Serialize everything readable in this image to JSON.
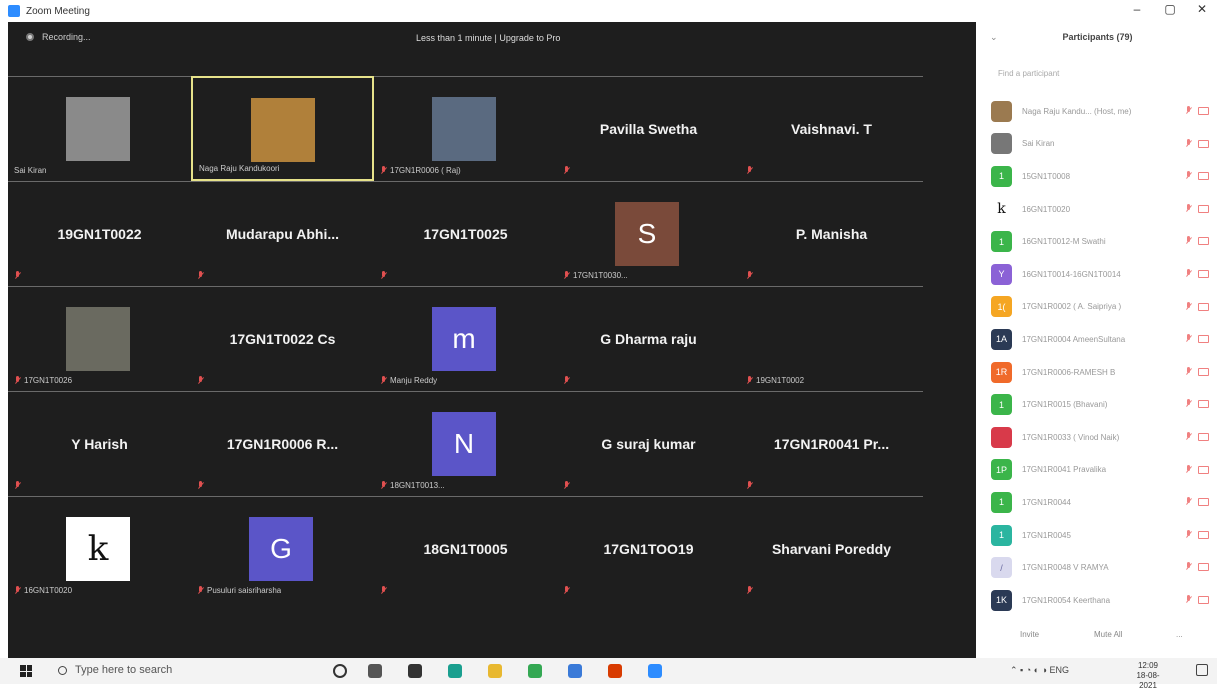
{
  "window": {
    "title": "Zoom Meeting",
    "minimize": "–",
    "maximize": "▢",
    "close": "✕"
  },
  "topbar": {
    "recording": "Recording...",
    "upgrade": "Less than 1 minute | Upgrade to Pro"
  },
  "tiles": [
    {
      "kind": "photo",
      "label": "Sai Kiran",
      "photo": "#8a8a8a",
      "muted": false
    },
    {
      "kind": "photo",
      "label": "Naga Raju Kandukoori",
      "photo": "#b0803a",
      "muted": false,
      "active": true
    },
    {
      "kind": "photo",
      "label": "17GN1R0006 ( Raj)",
      "photo": "#5a6a80",
      "muted": true
    },
    {
      "kind": "name",
      "name": "Pavilla Swetha",
      "muted": true
    },
    {
      "kind": "name",
      "name": "Vaishnavi. T",
      "muted": true
    },
    {
      "kind": "name",
      "name": "19GN1T0022",
      "muted": true
    },
    {
      "kind": "name",
      "name": "Mudarapu  Abhi...",
      "muted": true
    },
    {
      "kind": "name",
      "name": "17GN1T0025",
      "muted": true
    },
    {
      "kind": "letter",
      "letter": "S",
      "color": "#7a4a3a",
      "label": "17GN1T0030...",
      "muted": true
    },
    {
      "kind": "name",
      "name": "P. Manisha",
      "muted": true
    },
    {
      "kind": "photo",
      "label": "17GN1T0026",
      "photo": "#6a6a60",
      "muted": true
    },
    {
      "kind": "name",
      "name": "17GN1T0022 Cs",
      "muted": true
    },
    {
      "kind": "letter",
      "letter": "m",
      "color": "#5b55c8",
      "label": "Manju Reddy",
      "muted": true
    },
    {
      "kind": "name",
      "name": "G Dharma raju",
      "muted": true
    },
    {
      "kind": "blank",
      "label": "19GN1T0002",
      "muted": true
    },
    {
      "kind": "name",
      "name": "Y Harish",
      "muted": true
    },
    {
      "kind": "name",
      "name": "17GN1R0006  R...",
      "muted": true
    },
    {
      "kind": "letter",
      "letter": "N",
      "color": "#5b55c8",
      "label": "18GN1T0013...",
      "muted": true
    },
    {
      "kind": "name",
      "name": "G suraj kumar",
      "muted": true
    },
    {
      "kind": "name",
      "name": "17GN1R0041  Pr...",
      "muted": true
    },
    {
      "kind": "letter",
      "letter": "k",
      "color": "#ffffff",
      "textcolor": "#111111",
      "label": "16GN1T0020",
      "muted": true
    },
    {
      "kind": "letter",
      "letter": "G",
      "color": "#5b55c8",
      "label": "Pusuluri saisriharsha",
      "muted": true
    },
    {
      "kind": "name",
      "name": "18GN1T0005",
      "muted": true
    },
    {
      "kind": "name",
      "name": "17GN1TOO19",
      "muted": true
    },
    {
      "kind": "name",
      "name": "Sharvani Poreddy",
      "muted": true
    }
  ],
  "panel": {
    "title": "Participants (79)",
    "search_placeholder": "Find a participant",
    "invite": "Invite",
    "mute_all": "Mute All",
    "more": "...",
    "participants": [
      {
        "avatar": "",
        "color": "#9b7a50",
        "name": "Naga Raju Kandu...  (Host, me)"
      },
      {
        "avatar": "",
        "color": "#777777",
        "name": "Sai Kiran"
      },
      {
        "avatar": "1",
        "color": "#3bb54a",
        "name": "15GN1T0008"
      },
      {
        "avatar": "k",
        "color": "#ffffff",
        "name": "16GN1T0020"
      },
      {
        "avatar": "1",
        "color": "#3bb54a",
        "name": "16GN1T0012-M Swathi"
      },
      {
        "avatar": "Y",
        "color": "#8b62d6",
        "name": "16GN1T0014-16GN1T0014"
      },
      {
        "avatar": "1(",
        "color": "#f5a623",
        "name": "17GN1R0002 ( A. Saipriya )"
      },
      {
        "avatar": "1A",
        "color": "#2b3a55",
        "name": "17GN1R0004 AmeenSultana"
      },
      {
        "avatar": "1R",
        "color": "#f06a2a",
        "name": "17GN1R0006-RAMESH B"
      },
      {
        "avatar": "1",
        "color": "#3bb54a",
        "name": "17GN1R0015 (Bhavani)"
      },
      {
        "avatar": "",
        "color": "#d83a4a",
        "name": "17GN1R0033 ( Vinod Naik)"
      },
      {
        "avatar": "1P",
        "color": "#3bb54a",
        "name": "17GN1R0041 Pravalika"
      },
      {
        "avatar": "1",
        "color": "#3bb54a",
        "name": "17GN1R0044"
      },
      {
        "avatar": "1",
        "color": "#2bb5a0",
        "name": "17GN1R0045"
      },
      {
        "avatar": "/",
        "color": "#d9d9ee",
        "name": "17GN1R0048 V RAMYA"
      },
      {
        "avatar": "1K",
        "color": "#2b3a55",
        "name": "17GN1R0054 Keerthana"
      }
    ]
  },
  "taskbar": {
    "search": "Type here to search",
    "lang": "ENG",
    "time": "12:09",
    "date": "18-08-2021",
    "apps": [
      {
        "name": "cortana-icon",
        "color": "#333333"
      },
      {
        "name": "task-view-icon",
        "color": "#555555"
      },
      {
        "name": "store-icon",
        "color": "#333333"
      },
      {
        "name": "edge-icon",
        "color": "#1a9f8f"
      },
      {
        "name": "file-explorer-icon",
        "color": "#e8b830"
      },
      {
        "name": "chrome-icon",
        "color": "#34a853"
      },
      {
        "name": "app-icon",
        "color": "#3a7ad8"
      },
      {
        "name": "office-icon",
        "color": "#d83b01"
      },
      {
        "name": "zoom-icon",
        "color": "#2d8cff"
      }
    ]
  }
}
